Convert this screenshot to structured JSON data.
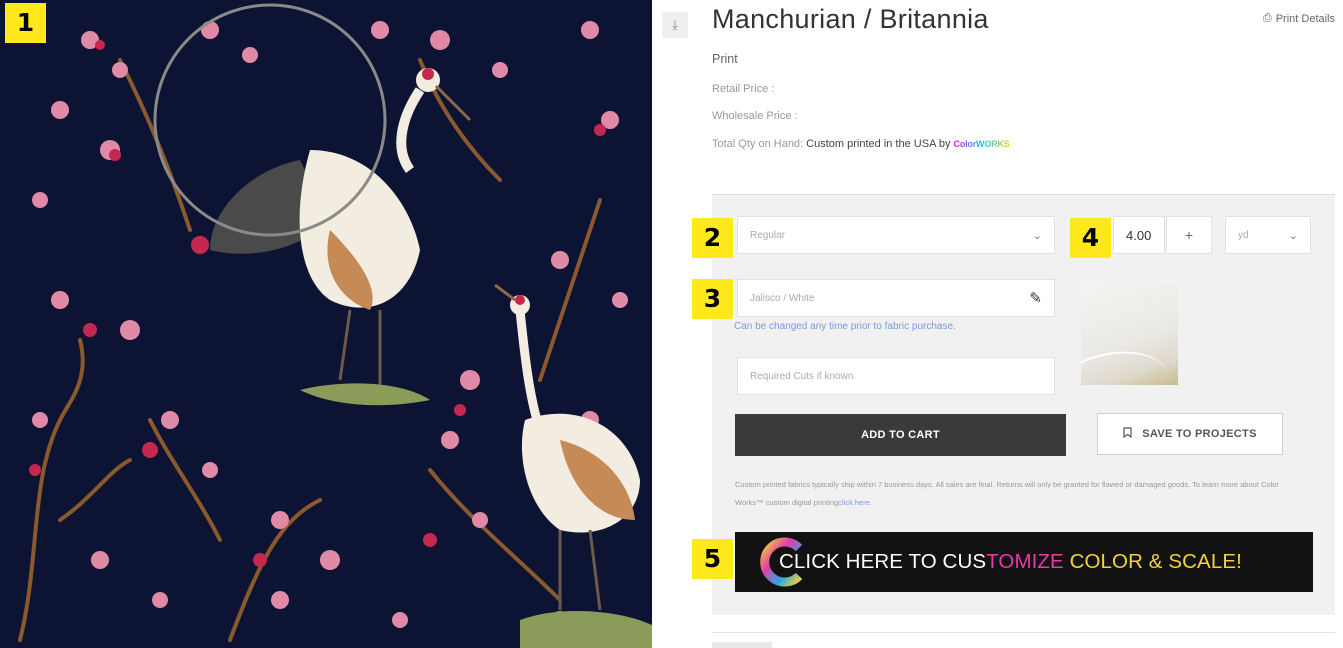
{
  "markers": [
    "1",
    "2",
    "3",
    "4",
    "5"
  ],
  "product": {
    "title": "Manchurian / Britannia",
    "type": "Print",
    "retail_price_label": "Retail Price :",
    "wholesale_price_label": "Wholesale Price :",
    "qty_label": "Total Qty on Hand:",
    "qty_value": "Custom printed in the USA by",
    "logo_text": "ColorWORKS",
    "download_icon": "download-icon"
  },
  "header": {
    "print_details_label": "Print Details",
    "print_icon": "printer-icon"
  },
  "options": {
    "fabric_selected": "Regular",
    "quantity": "4.00",
    "plus_label": "+",
    "unit_selected": "yd",
    "colorway_value": "Jalisco / White",
    "change_note": "Can be changed any time prior to fabric purchase.",
    "cuts_placeholder": "Required Cuts if known",
    "edit_icon": "pencil-icon",
    "chevron_icon": "chevron-down-icon"
  },
  "actions": {
    "add_to_cart": "ADD TO CART",
    "save_projects": "SAVE TO PROJECTS",
    "bookmark_icon": "bookmark-icon"
  },
  "disclaimer": {
    "text": "Custom printed fabrics typically ship within 7 business days. All sales are final. Returns will only be granted for flawed or damaged goods. To learn more about Color Works™ custom digital printing",
    "link": "click here",
    "end": "."
  },
  "banner": {
    "part1": "CLICK HERE TO CUS",
    "part2": "TOMIZE",
    "part3": " COLOR & SCALE!"
  },
  "colors": {
    "accent_blue": "#7a9ad6",
    "button_dark": "#3a3a3a",
    "marker_yellow": "#ffe81c",
    "fabric_navy": "#0d1433"
  }
}
